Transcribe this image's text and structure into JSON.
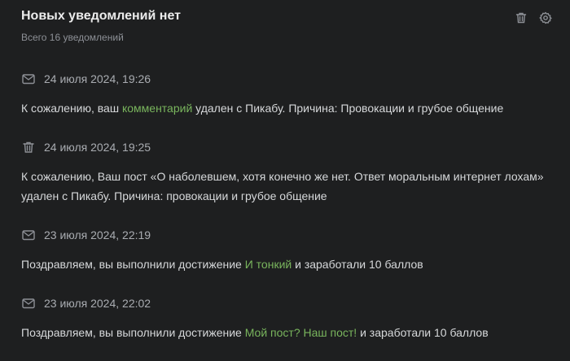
{
  "header": {
    "title": "Новых уведомлений нет",
    "subtitle": "Всего 16 уведомлений",
    "icons": [
      "trash-icon",
      "gear-icon"
    ]
  },
  "colors": {
    "background": "#1e1f20",
    "link": "#79b55d",
    "muted": "#8d9096"
  },
  "notifications": [
    {
      "icon": "mail-icon",
      "date": "24 июля 2024, 19:26",
      "text_before": "К сожалению, ваш ",
      "link": "комментарий",
      "text_after": " удален с Пикабу. Причина: Провокации и грубое общение"
    },
    {
      "icon": "trash-icon",
      "date": "24 июля 2024, 19:25",
      "text_line1": "К сожалению, Ваш пост «О наболевшем, хотя конечно же нет. Ответ моральным интернет лохам»",
      "text_line2": "удален с Пикабу. Причина: провокации и грубое общение"
    },
    {
      "icon": "mail-icon",
      "date": "23 июля 2024, 22:19",
      "text_before": "Поздравляем, вы выполнили достижение ",
      "link": "И тонкий",
      "text_after": " и заработали 10 баллов"
    },
    {
      "icon": "mail-icon",
      "date": "23 июля 2024, 22:02",
      "text_before": "Поздравляем, вы выполнили достижение ",
      "link": "Мой пост? Наш пост!",
      "text_after": " и заработали 10 баллов"
    }
  ]
}
